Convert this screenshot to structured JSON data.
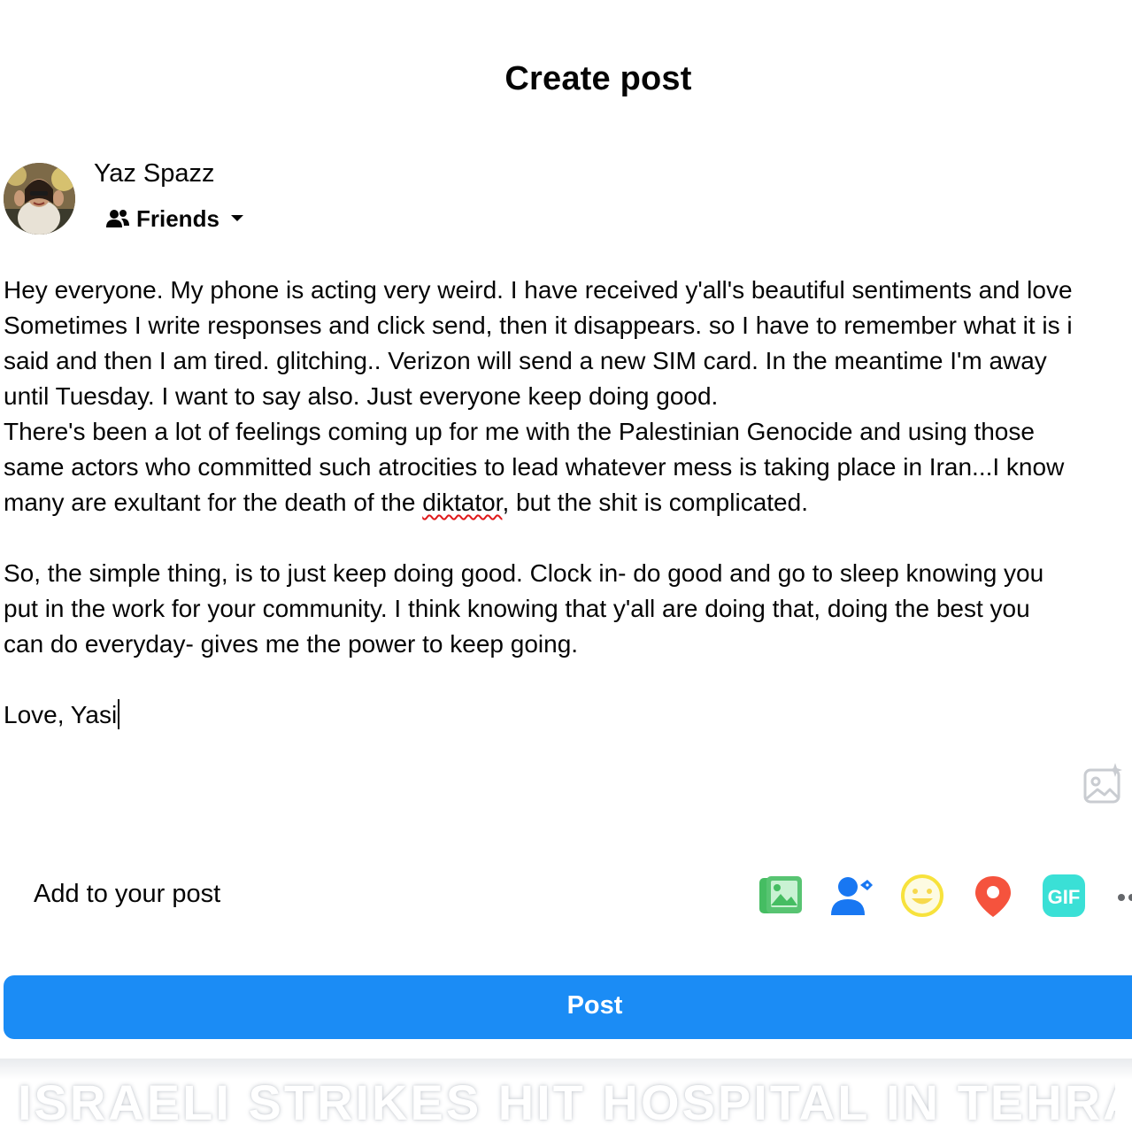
{
  "dialog": {
    "title": "Create post"
  },
  "author": {
    "name": "Yaz Spazz",
    "audience_label": "Friends",
    "audience_icon": "friends-icon"
  },
  "composer": {
    "lines": [
      "Hey everyone. My phone is acting very weird. I have received y'all's beautiful sentiments and love",
      "Sometimes I write responses and click send, then it disappears. so I have to remember what it is i",
      "said and then I am tired. glitching.. Verizon will send a new SIM card. In the meantime I'm away",
      "until Tuesday. I want to say also. Just everyone keep doing good.",
      "There's been a lot of feelings coming up for me with the Palestinian Genocide and using those",
      "same actors who committed such atrocities to lead whatever mess is taking place in Iran...I know"
    ],
    "line7_before": "many are exultant for the death of the ",
    "line7_misspelled": "diktator",
    "line7_after": ", but the shit is complicated.",
    "lines_b": [
      "So, the simple thing, is to just keep doing good. Clock in- do good and go to sleep knowing you",
      "put in the work for your community. I think knowing that y'all are doing that, doing the best you",
      "can do everyday- gives me the power to keep going."
    ],
    "signoff": "Love, Yasi"
  },
  "add_to_post": {
    "label": "Add to your post",
    "tools": [
      {
        "name": "photo-video-icon",
        "color": "#45bd62"
      },
      {
        "name": "tag-people-icon",
        "color": "#1877f2"
      },
      {
        "name": "feeling-icon",
        "color": "#f7d94c"
      },
      {
        "name": "check-in-icon",
        "color": "#f5533d"
      },
      {
        "name": "gif-icon",
        "color": "#3ae0d6"
      },
      {
        "name": "more-options-icon",
        "color": "#65676b"
      }
    ]
  },
  "post_button": {
    "label": "Post",
    "color": "#1b8cf5"
  },
  "background": {
    "headline": "ISRAELI STRIKES HIT HOSPITAL IN TEHRAN"
  }
}
